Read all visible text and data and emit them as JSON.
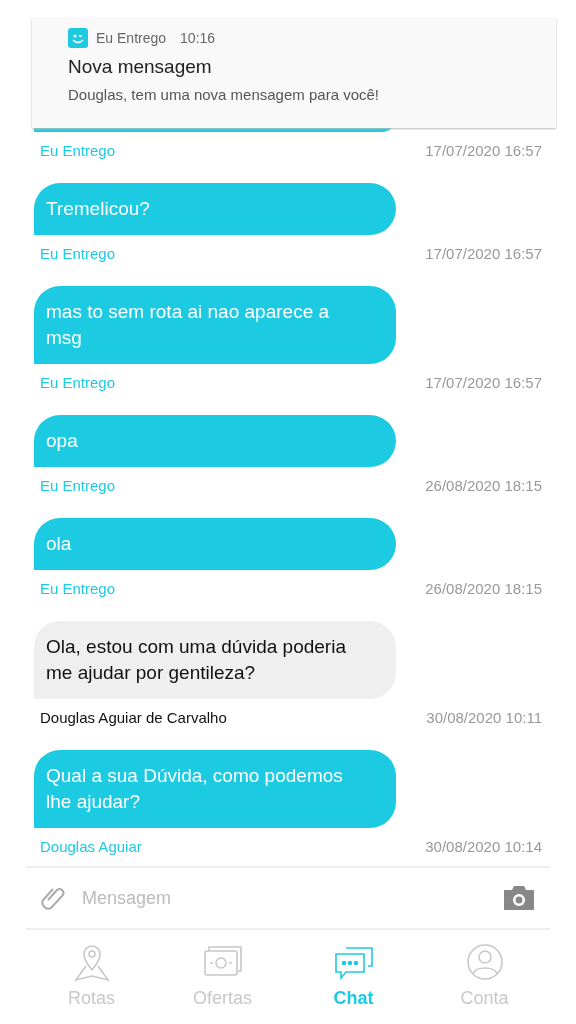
{
  "notification": {
    "app": "Eu Entrego",
    "time": "10:16",
    "title": "Nova mensagem",
    "body": "Douglas, tem uma nova mensagem para você!"
  },
  "messages": [
    {
      "mine": true,
      "sender": "Eu Entrego",
      "time": "17/07/2020 16:57"
    },
    {
      "mine": true,
      "text": "Tremelicou?",
      "sender": "Eu Entrego",
      "time": "17/07/2020 16:57"
    },
    {
      "mine": true,
      "text": "mas to sem rota ai nao aparece a msg",
      "sender": "Eu Entrego",
      "time": "17/07/2020 16:57"
    },
    {
      "mine": true,
      "text": "opa",
      "sender": "Eu Entrego",
      "time": "26/08/2020 18:15"
    },
    {
      "mine": true,
      "text": "ola",
      "sender": "Eu Entrego",
      "time": "26/08/2020 18:15"
    },
    {
      "mine": false,
      "text": "Ola, estou com uma dúvida poderia me ajudar por gentileza?",
      "sender": "Douglas Aguiar de Carvalho",
      "time": "30/08/2020 10:11"
    },
    {
      "mine": true,
      "text": "Qual a sua Dúvida, como podemos lhe ajudar?",
      "sender": "Douglas Aguiar",
      "time": "30/08/2020 10:14"
    }
  ],
  "composer": {
    "placeholder": "Mensagem"
  },
  "nav": [
    {
      "kind": "routes",
      "label": "Rotas",
      "selected": false
    },
    {
      "kind": "offers",
      "label": "Ofertas",
      "selected": false
    },
    {
      "kind": "chat",
      "label": "Chat",
      "selected": true
    },
    {
      "kind": "account",
      "label": "Conta",
      "selected": false
    }
  ]
}
